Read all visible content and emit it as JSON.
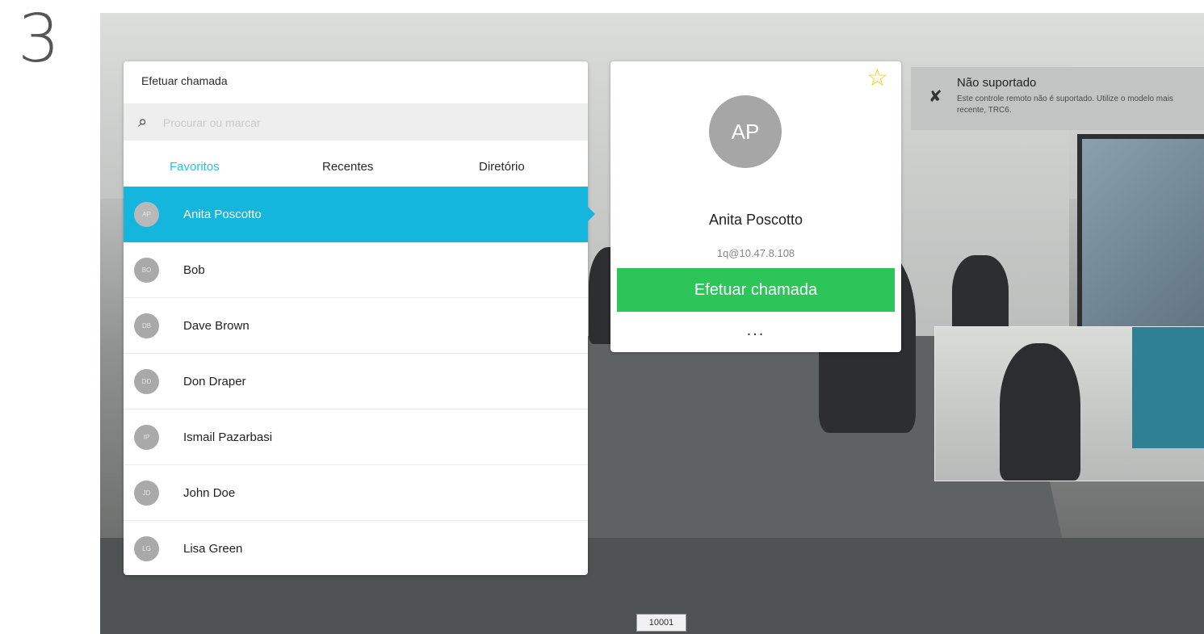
{
  "step_number": "3",
  "panel": {
    "title": "Efetuar chamada",
    "search_placeholder": "Procurar ou marcar",
    "tabs": [
      {
        "label": "Favoritos",
        "active": true
      },
      {
        "label": "Recentes",
        "active": false
      },
      {
        "label": "Diretório",
        "active": false
      }
    ],
    "contacts": [
      {
        "initials": "AP",
        "name": "Anita Poscotto",
        "selected": true
      },
      {
        "initials": "BO",
        "name": "Bob",
        "selected": false
      },
      {
        "initials": "DB",
        "name": "Dave Brown",
        "selected": false
      },
      {
        "initials": "DD",
        "name": "Don Draper",
        "selected": false
      },
      {
        "initials": "IP",
        "name": "Ismail Pazarbasi",
        "selected": false
      },
      {
        "initials": "JD",
        "name": "John Doe",
        "selected": false
      },
      {
        "initials": "LG",
        "name": "Lisa Green",
        "selected": false
      }
    ]
  },
  "card": {
    "initials": "AP",
    "name": "Anita Poscotto",
    "address": "1q@10.47.8.108",
    "call_button": "Efetuar chamada",
    "more_label": "...",
    "favorite_icon": "star-icon"
  },
  "notice": {
    "title": "Não suportado",
    "text": "Este controle remoto não é suportado. Utilize o modelo mais recente, TRC6.",
    "icon": "microphone-muted-icon"
  },
  "badge": "10001",
  "colors": {
    "accent": "#14b6de",
    "tab_active": "#29c0e8",
    "call_green": "#2dc45a",
    "star": "#f2d100"
  }
}
